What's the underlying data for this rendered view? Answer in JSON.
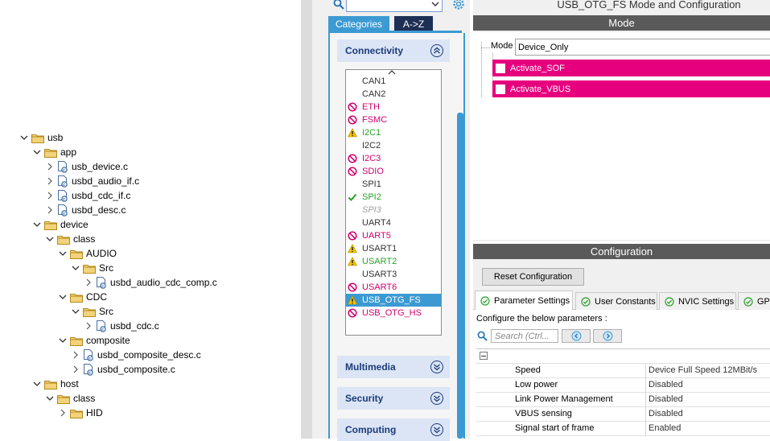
{
  "tree": {
    "items": [
      {
        "label": "usb",
        "kind": "folder"
      },
      {
        "label": "app",
        "kind": "folder"
      },
      {
        "label": "usb_device.c",
        "kind": "file"
      },
      {
        "label": "usbd_audio_if.c",
        "kind": "file"
      },
      {
        "label": "usbd_cdc_if.c",
        "kind": "file"
      },
      {
        "label": "usbd_desc.c",
        "kind": "file"
      },
      {
        "label": "device",
        "kind": "folder"
      },
      {
        "label": "class",
        "kind": "folder"
      },
      {
        "label": "AUDIO",
        "kind": "folder"
      },
      {
        "label": "Src",
        "kind": "folder"
      },
      {
        "label": "usbd_audio_cdc_comp.c",
        "kind": "file"
      },
      {
        "label": "CDC",
        "kind": "folder"
      },
      {
        "label": "Src",
        "kind": "folder"
      },
      {
        "label": "usbd_cdc.c",
        "kind": "file"
      },
      {
        "label": "composite",
        "kind": "folder"
      },
      {
        "label": "usbd_composite_desc.c",
        "kind": "file"
      },
      {
        "label": "usbd_composite.c",
        "kind": "file"
      },
      {
        "label": "host",
        "kind": "folder"
      },
      {
        "label": "class",
        "kind": "folder"
      },
      {
        "label": "HID",
        "kind": "folder"
      }
    ]
  },
  "categories": {
    "search_placeholder": "",
    "tab_categories": "Categories",
    "tab_az": "A->Z",
    "sections": {
      "connectivity": "Connectivity",
      "multimedia": "Multimedia",
      "security": "Security",
      "computing": "Computing"
    },
    "peripherals": [
      {
        "label": "CAN1",
        "status": "none",
        "color": "#333333"
      },
      {
        "label": "CAN2",
        "status": "none",
        "color": "#333333"
      },
      {
        "label": "ETH",
        "status": "blocked",
        "color": "#d4006c"
      },
      {
        "label": "FSMC",
        "status": "blocked",
        "color": "#d4006c"
      },
      {
        "label": "I2C1",
        "status": "warning",
        "color": "#2aa12a"
      },
      {
        "label": "I2C2",
        "status": "none",
        "color": "#333333"
      },
      {
        "label": "I2C3",
        "status": "blocked",
        "color": "#d4006c"
      },
      {
        "label": "SDIO",
        "status": "blocked",
        "color": "#d4006c"
      },
      {
        "label": "SPI1",
        "status": "none",
        "color": "#333333"
      },
      {
        "label": "SPI2",
        "status": "ok",
        "color": "#2aa12a"
      },
      {
        "label": "SPI3",
        "status": "disabled",
        "color": "#a0a0a0"
      },
      {
        "label": "UART4",
        "status": "none",
        "color": "#333333"
      },
      {
        "label": "UART5",
        "status": "blocked",
        "color": "#d4006c"
      },
      {
        "label": "USART1",
        "status": "warning",
        "color": "#333333"
      },
      {
        "label": "USART2",
        "status": "warning",
        "color": "#2aa12a"
      },
      {
        "label": "USART3",
        "status": "none",
        "color": "#333333"
      },
      {
        "label": "USART6",
        "status": "blocked",
        "color": "#d4006c"
      },
      {
        "label": "USB_OTG_FS",
        "status": "warning",
        "color": "#ffffff"
      },
      {
        "label": "USB_OTG_HS",
        "status": "blocked",
        "color": "#d4006c"
      }
    ],
    "selected_peripheral": "USB_OTG_FS"
  },
  "mode_panel": {
    "window_title": "USB_OTG_FS Mode and Configuration",
    "header": "Mode",
    "mode_label": "Mode",
    "mode_value": "Device_Only",
    "activate_sof": "Activate_SOF",
    "activate_vbus": "Activate_VBUS",
    "accent_color": "#e6007e"
  },
  "config_panel": {
    "header": "Configuration",
    "reset_button": "Reset Configuration",
    "tabs": [
      "Parameter Settings",
      "User Constants",
      "NVIC Settings",
      "GPIO Settings"
    ],
    "hint": "Configure the below parameters :",
    "search_placeholder": "Search (Ctrl...",
    "params": [
      {
        "name": "Speed",
        "value": "Device Full Speed 12MBit/s"
      },
      {
        "name": "Low power",
        "value": "Disabled"
      },
      {
        "name": "Link Power Management",
        "value": "Disabled"
      },
      {
        "name": "VBUS sensing",
        "value": "Disabled"
      },
      {
        "name": "Signal start of frame",
        "value": "Enabled"
      }
    ]
  }
}
